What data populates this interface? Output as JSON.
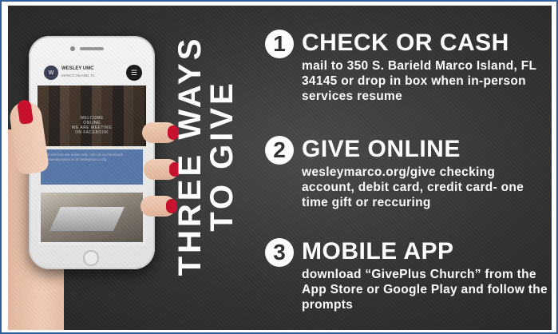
{
  "heading": {
    "line1": "THREE WAYS",
    "line2": "TO GIVE"
  },
  "phone": {
    "logo_text": "W",
    "title": "WESLEY UMC",
    "subtitle": "MARCO ISLAND, FL",
    "menu_icon": "menu-icon",
    "hero_lines": [
      "WELCOME",
      "ONLINE",
      "WE ARE MEETING",
      "ON FACEBOOK"
    ],
    "notice": "All services are online only. Join us on Facebook @wesleymarco or at wesleymarco.org"
  },
  "ways": [
    {
      "number": "1",
      "title": "CHECK OR CASH",
      "body": "mail to 350 S. Barield Marco Island, FL 34145 or drop in box when in-person services resume"
    },
    {
      "number": "2",
      "title": "GIVE ONLINE",
      "body": "wesleymarco.org/give checking account, debit card, credit card- one time gift or reccuring"
    },
    {
      "number": "3",
      "title": "MOBILE APP",
      "body": "download “GivePlus Church” from the App Store or Google Play and follow the prompts"
    }
  ],
  "colors": {
    "background": "#333333",
    "text": "#ffffff",
    "frame": "#2f5f9a",
    "nail": "#c8102e",
    "notice": "#5877a8"
  }
}
